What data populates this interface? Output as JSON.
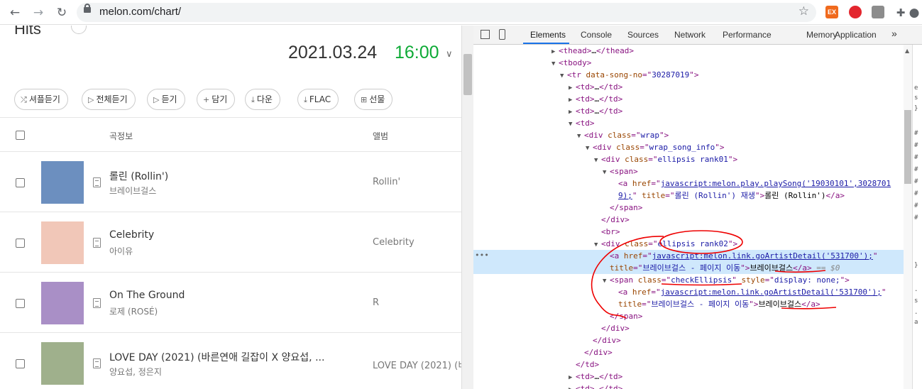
{
  "browser": {
    "url": "melon.com/chart/",
    "extensions": [
      {
        "name": "ext-icon-1",
        "label": "EX",
        "color": "#f06a1d"
      },
      {
        "name": "ext-icon-2",
        "label": "",
        "color": "#e3262e"
      },
      {
        "name": "ext-icon-3",
        "label": "",
        "color": "#8c8c8c"
      }
    ]
  },
  "page": {
    "title": "Hits",
    "date": "2021.03.24",
    "time": "16:00",
    "buttons": [
      {
        "label": "셔플듣기",
        "icon": "shuffle-icon",
        "glyph": "⤮"
      },
      {
        "label": "전체듣기",
        "icon": "play-icon",
        "glyph": "▷"
      },
      {
        "label": "듣기",
        "icon": "play-icon",
        "glyph": "▷"
      },
      {
        "label": "담기",
        "icon": "plus-icon",
        "glyph": "+"
      },
      {
        "label": "다운",
        "icon": "download-icon",
        "glyph": "⤓"
      },
      {
        "label": "FLAC",
        "icon": "download-icon",
        "glyph": "⤓"
      },
      {
        "label": "선물",
        "icon": "gift-icon",
        "glyph": "⊞"
      }
    ],
    "columns": {
      "song_info": "곡정보",
      "album": "앨범"
    },
    "rows": [
      {
        "song": "롤린 (Rollin')",
        "artist": "브레이브걸스",
        "album": "Rollin'",
        "thumb_color": "#6c8fbf"
      },
      {
        "song": "Celebrity",
        "artist": "아이유",
        "album": "Celebrity",
        "thumb_color": "#f1c7b8"
      },
      {
        "song": "On The Ground",
        "artist": "로제 (ROSÉ)",
        "album": "R",
        "thumb_color": "#a98fc6"
      },
      {
        "song": "LOVE DAY (2021) (바른연애 길잡이 X 양요섭, ...",
        "artist": "양요섭, 정은지",
        "album": "LOVE DAY (2021) (비",
        "thumb_color": "#9fb08c"
      }
    ]
  },
  "devtools": {
    "tabs": [
      "Elements",
      "Console",
      "Sources",
      "Network",
      "Performance",
      "Memory",
      "Application"
    ],
    "active_tab": "Elements",
    "more": "»",
    "lines": [
      {
        "i": 10,
        "tri": "▶",
        "parts": [
          [
            "tag",
            "<thead>"
          ],
          [
            "tx",
            "…"
          ],
          [
            "tag",
            "</thead>"
          ]
        ]
      },
      {
        "i": 10,
        "tri": "▼",
        "parts": [
          [
            "tag",
            "<tbody>"
          ]
        ]
      },
      {
        "i": 11,
        "tri": "▼",
        "parts": [
          [
            "tag",
            "<tr "
          ],
          [
            "an",
            "data-song-no"
          ],
          [
            "tag",
            "=\""
          ],
          [
            "av",
            "30287019"
          ],
          [
            "tag",
            "\">"
          ]
        ]
      },
      {
        "i": 12,
        "tri": "▶",
        "parts": [
          [
            "tag",
            "<td>"
          ],
          [
            "tx",
            "…"
          ],
          [
            "tag",
            "</td>"
          ]
        ]
      },
      {
        "i": 12,
        "tri": "▶",
        "parts": [
          [
            "tag",
            "<td>"
          ],
          [
            "tx",
            "…"
          ],
          [
            "tag",
            "</td>"
          ]
        ]
      },
      {
        "i": 12,
        "tri": "▶",
        "parts": [
          [
            "tag",
            "<td>"
          ],
          [
            "tx",
            "…"
          ],
          [
            "tag",
            "</td>"
          ]
        ]
      },
      {
        "i": 12,
        "tri": "▼",
        "parts": [
          [
            "tag",
            "<td>"
          ]
        ]
      },
      {
        "i": 13,
        "tri": "▼",
        "parts": [
          [
            "tag",
            "<div "
          ],
          [
            "an",
            "class"
          ],
          [
            "tag",
            "=\""
          ],
          [
            "av",
            "wrap"
          ],
          [
            "tag",
            "\">"
          ]
        ]
      },
      {
        "i": 14,
        "tri": "▼",
        "parts": [
          [
            "tag",
            "<div "
          ],
          [
            "an",
            "class"
          ],
          [
            "tag",
            "=\""
          ],
          [
            "av",
            "wrap_song_info"
          ],
          [
            "tag",
            "\">"
          ]
        ]
      },
      {
        "i": 15,
        "tri": "▼",
        "parts": [
          [
            "tag",
            "<div "
          ],
          [
            "an",
            "class"
          ],
          [
            "tag",
            "=\""
          ],
          [
            "av",
            "ellipsis rank01"
          ],
          [
            "tag",
            "\">"
          ]
        ]
      },
      {
        "i": 16,
        "tri": "▼",
        "parts": [
          [
            "tag",
            "<span>"
          ]
        ]
      },
      {
        "i": 17,
        "tri": "",
        "parts": [
          [
            "tag",
            "<a "
          ],
          [
            "an",
            "href"
          ],
          [
            "tag",
            "=\""
          ],
          [
            "lk",
            "javascript:melon.play.playSong('19030101',3028701"
          ]
        ]
      },
      {
        "i": 17,
        "tri": "",
        "parts": [
          [
            "lk",
            "9);"
          ],
          [
            "tag",
            "\" "
          ],
          [
            "an",
            "title"
          ],
          [
            "tag",
            "=\""
          ],
          [
            "av",
            "롤린 (Rollin') 재생"
          ],
          [
            "tag",
            "\">"
          ],
          [
            "tx",
            "롤린 (Rollin')"
          ],
          [
            "tag",
            "</a>"
          ]
        ]
      },
      {
        "i": 16,
        "tri": "",
        "parts": [
          [
            "tag",
            "</span>"
          ]
        ]
      },
      {
        "i": 15,
        "tri": "",
        "parts": [
          [
            "tag",
            "</div>"
          ]
        ]
      },
      {
        "i": 15,
        "tri": "",
        "parts": [
          [
            "tag",
            "<br>"
          ]
        ]
      },
      {
        "i": 15,
        "tri": "▼",
        "parts": [
          [
            "tag",
            "<div "
          ],
          [
            "an",
            "class"
          ],
          [
            "tag",
            "=\""
          ],
          [
            "av",
            "ellipsis rank02"
          ],
          [
            "tag",
            "\">"
          ]
        ]
      },
      {
        "i": 16,
        "tri": "",
        "sel": true,
        "parts": [
          [
            "tag",
            "<a "
          ],
          [
            "an",
            "href"
          ],
          [
            "tag",
            "=\""
          ],
          [
            "lk",
            "javascript:melon.link.goArtistDetail('531700');"
          ],
          [
            "tag",
            "\""
          ]
        ]
      },
      {
        "i": 16,
        "tri": "",
        "sel": true,
        "parts": [
          [
            "an",
            "title"
          ],
          [
            "tag",
            "=\""
          ],
          [
            "av",
            "브레이브걸스 - 페이지 이동"
          ],
          [
            "tag",
            "\">"
          ],
          [
            "tx",
            "브레이브걸스"
          ],
          [
            "tag",
            "</a>"
          ],
          [
            "eq",
            " == $0"
          ]
        ]
      },
      {
        "i": 16,
        "tri": "▼",
        "parts": [
          [
            "tag",
            "<span "
          ],
          [
            "an",
            "class"
          ],
          [
            "tag",
            "=\""
          ],
          [
            "av",
            "checkEllipsis"
          ],
          [
            "tag",
            "\" "
          ],
          [
            "an",
            "style"
          ],
          [
            "tag",
            "=\""
          ],
          [
            "av",
            "display: none;"
          ],
          [
            "tag",
            "\">"
          ]
        ]
      },
      {
        "i": 17,
        "tri": "",
        "parts": [
          [
            "tag",
            "<a "
          ],
          [
            "an",
            "href"
          ],
          [
            "tag",
            "=\""
          ],
          [
            "lk",
            "javascript:melon.link.goArtistDetail('531700');"
          ],
          [
            "tag",
            "\""
          ]
        ]
      },
      {
        "i": 17,
        "tri": "",
        "parts": [
          [
            "an",
            "title"
          ],
          [
            "tag",
            "=\""
          ],
          [
            "av",
            "브레이브걸스 - 페이지 이동"
          ],
          [
            "tag",
            "\">"
          ],
          [
            "tx",
            "브레이브걸스"
          ],
          [
            "tag",
            "</a>"
          ]
        ]
      },
      {
        "i": 16,
        "tri": "",
        "parts": [
          [
            "tag",
            "</span>"
          ]
        ]
      },
      {
        "i": 15,
        "tri": "",
        "parts": [
          [
            "tag",
            "</div>"
          ]
        ]
      },
      {
        "i": 14,
        "tri": "",
        "parts": [
          [
            "tag",
            "</div>"
          ]
        ]
      },
      {
        "i": 13,
        "tri": "",
        "parts": [
          [
            "tag",
            "</div>"
          ]
        ]
      },
      {
        "i": 12,
        "tri": "",
        "parts": [
          [
            "tag",
            "</td>"
          ]
        ]
      },
      {
        "i": 12,
        "tri": "▶",
        "parts": [
          [
            "tag",
            "<td>"
          ],
          [
            "tx",
            "…"
          ],
          [
            "tag",
            "</td>"
          ]
        ]
      },
      {
        "i": 12,
        "tri": "▶",
        "parts": [
          [
            "tag",
            "<td>"
          ],
          [
            "tx",
            "…"
          ],
          [
            "tag",
            "</td>"
          ]
        ]
      }
    ],
    "selected_dots": "•••",
    "styles_strip": [
      "e",
      "s",
      "}",
      "#",
      "#",
      "#",
      "#",
      "#",
      "#",
      "#",
      "#",
      "}",
      ".",
      "s",
      ".",
      "a"
    ]
  }
}
